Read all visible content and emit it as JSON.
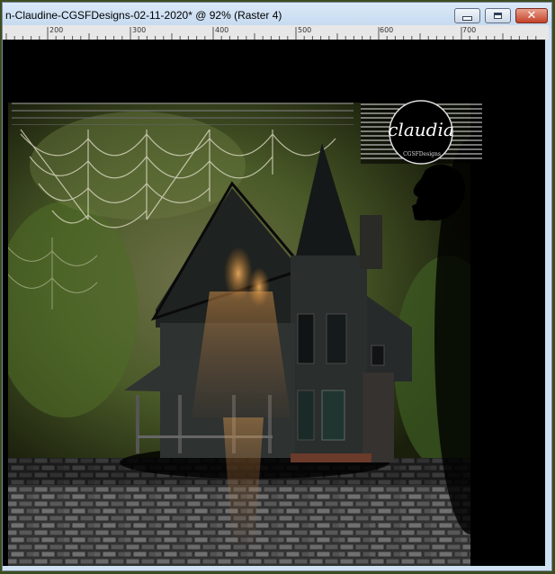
{
  "window": {
    "title": "n-Claudine-CGSFDesigns-02-11-2020* @  92% (Raster 4)",
    "buttons": {
      "minimize": "minimize",
      "maximize": "maximize",
      "close": "✕"
    }
  },
  "ruler": {
    "labels": [
      "200",
      "300",
      "400",
      "500",
      "600",
      "700"
    ]
  },
  "canvas": {
    "watermark_text": "claudia",
    "watermark_subtext": "CGSFDesigns"
  },
  "colors": {
    "frame": "#3d4c1f",
    "titlebar": "#cfe0f3",
    "close_button": "#c4412a"
  }
}
